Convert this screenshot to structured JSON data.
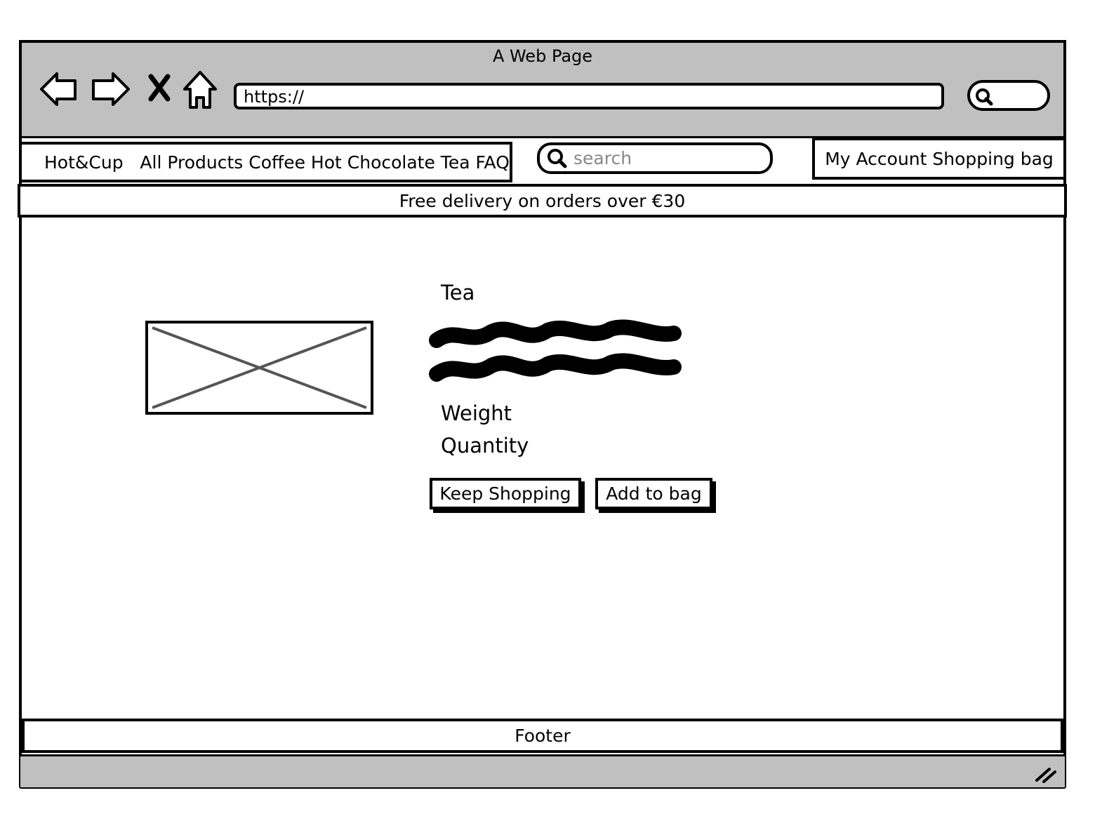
{
  "window": {
    "title": "A Web Page"
  },
  "browser": {
    "url": "https://",
    "icons": [
      "back-arrow-icon",
      "forward-arrow-icon",
      "close-icon",
      "home-icon",
      "search-icon"
    ]
  },
  "site": {
    "nav_text": "Hot&Cup   All Products Coffee Hot Chocolate Tea FAQ",
    "search_placeholder": "search",
    "account_text": "My Account Shopping bag",
    "banner": "Free delivery on orders over €30"
  },
  "product": {
    "title": "Tea",
    "weight_label": "Weight",
    "quantity_label": "Quantity",
    "keep_shopping_label": "Keep Shopping",
    "add_to_bag_label": "Add to bag"
  },
  "footer": {
    "label": "Footer"
  },
  "colors": {
    "chrome": "#c0c0c0",
    "placeholder_text": "#888888",
    "image_cross": "#555555"
  }
}
